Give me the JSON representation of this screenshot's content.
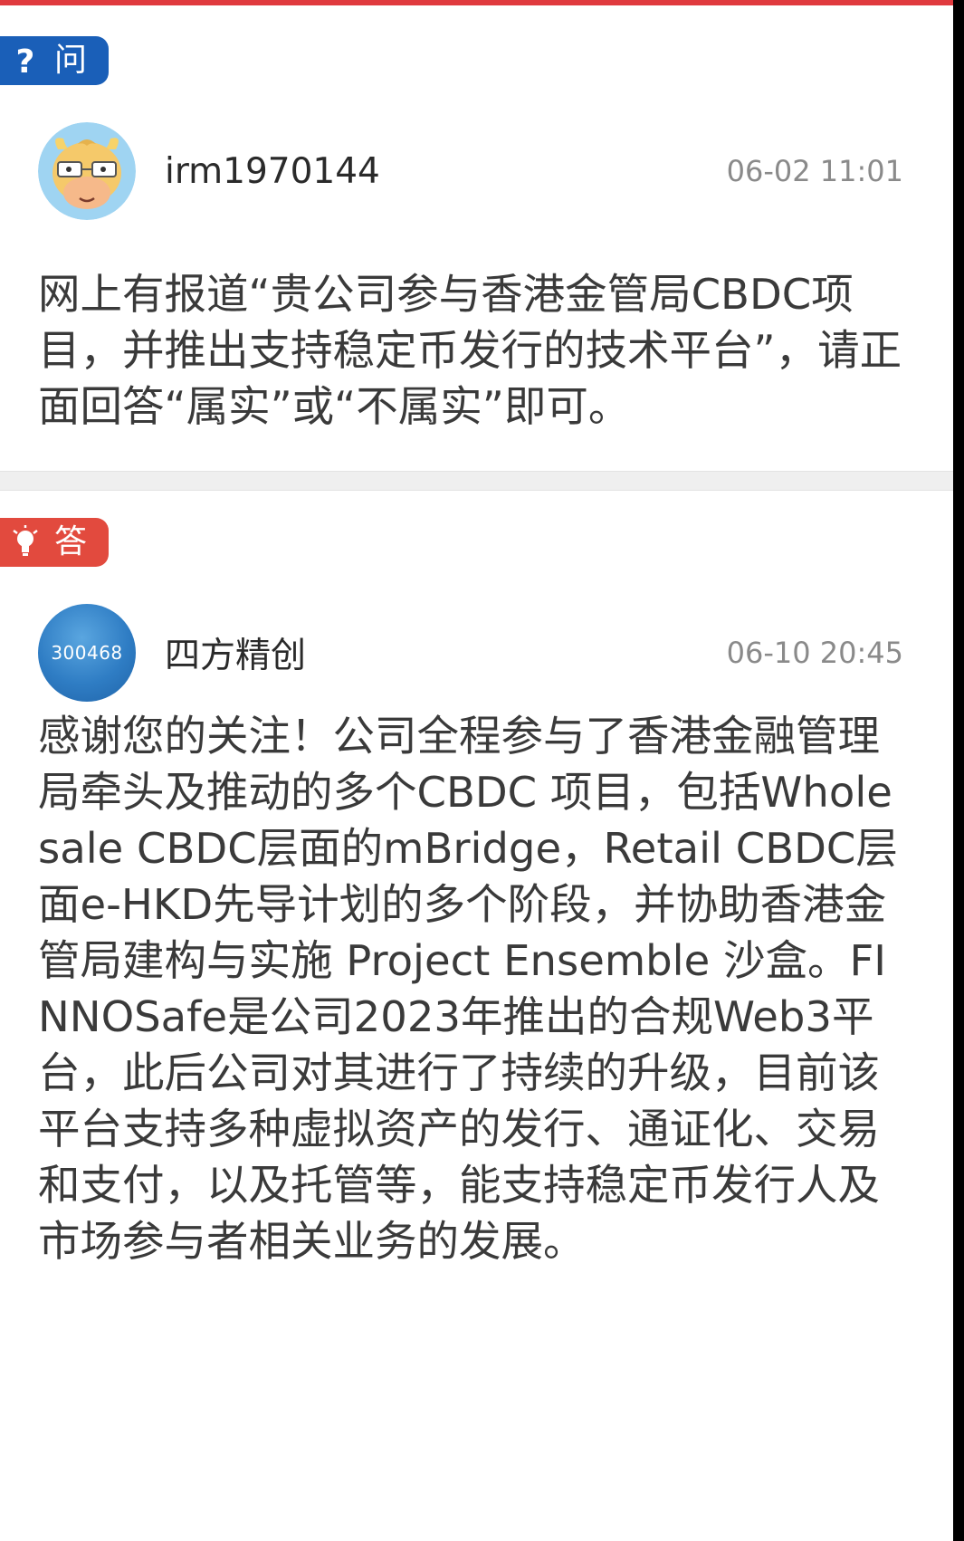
{
  "question": {
    "tag_label": "问",
    "tag_icon": "question-mark-icon",
    "username": "irm1970144",
    "avatar": "cartoon-cow-avatar",
    "time": "06-02 11:01",
    "text": "网上有报道“贵公司参与香港金管局CBDC项目，并推出支持稳定币发行的技术平台”，请正面回答“属实”或“不属实”即可。"
  },
  "answer": {
    "tag_label": "答",
    "tag_icon": "lightbulb-icon",
    "avatar_text": "300468",
    "username": "四方精创",
    "time": "06-10 20:45",
    "text": "感谢您的关注！公司全程参与了香港金融管理局牵头及推动的多个CBDC 项目，包括Wholesale CBDC层面的mBridge，Retail CBDC层面e-HKD先导计划的多个阶段，并协助香港金管局建构与实施 Project Ensemble 沙盒。FINNOSafe是公司2023年推出的合规Web3平台，此后公司对其进行了持续的升级，目前该平台支持多种虚拟资产的发行、通证化、交易和支付，以及托管等，能支持稳定币发行人及市场参与者相关业务的发展。"
  },
  "colors": {
    "question_tag": "#1a5fb8",
    "answer_tag": "#e24a3e",
    "top_accent": "#e03a3e"
  }
}
